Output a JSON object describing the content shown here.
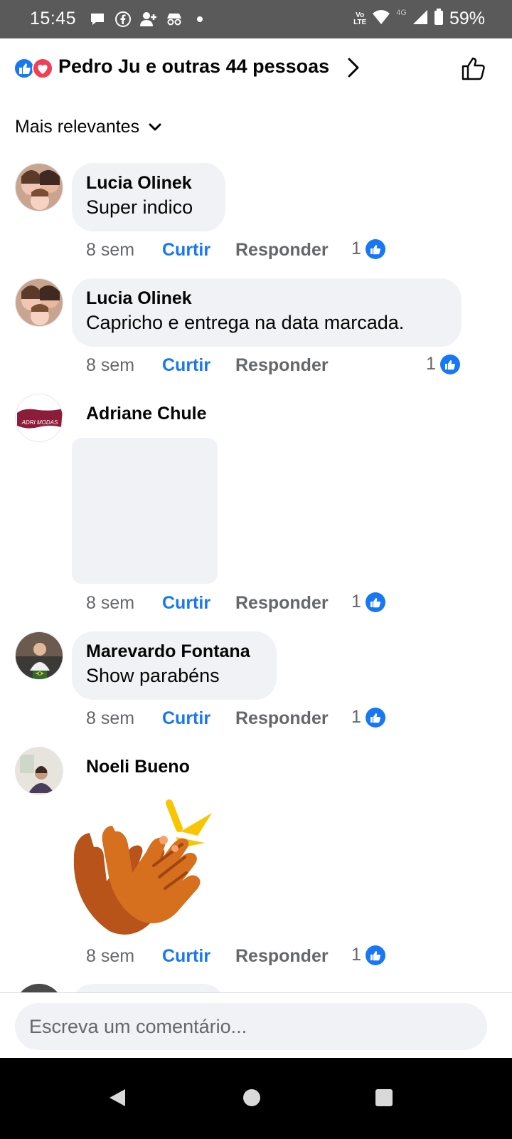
{
  "status_bar": {
    "time": "15:45",
    "battery": "59%",
    "network": "4G",
    "volte_top": "Vo",
    "volte_bottom": "LTE",
    "icons": [
      "message-bubble-icon",
      "facebook-icon",
      "add-person-icon",
      "incognito-icon",
      "dot-icon",
      "volte-icon",
      "wifi-icon",
      "signal-icon",
      "battery-icon"
    ]
  },
  "reactions": {
    "summary": "Pedro Ju e outras 44 pessoas",
    "icons": [
      "like-reaction-icon",
      "love-reaction-icon"
    ]
  },
  "sort": {
    "label": "Mais relevantes"
  },
  "comments": [
    {
      "author": "Lucia Olinek",
      "text": "Super indico",
      "time": "8 sem",
      "like": "Curtir",
      "reply": "Responder",
      "likes": "1"
    },
    {
      "author": "Lucia Olinek",
      "text": "Capricho e entrega na data marcada.",
      "time": "8 sem",
      "like": "Curtir",
      "reply": "Responder",
      "likes": "1"
    },
    {
      "author": "Adriane Chule",
      "avatar_text": "ADRI MODAS",
      "time": "8 sem",
      "like": "Curtir",
      "reply": "Responder",
      "likes": "1"
    },
    {
      "author": "Marevardo Fontana",
      "text": "Show parabéns",
      "time": "8 sem",
      "like": "Curtir",
      "reply": "Responder",
      "likes": "1"
    },
    {
      "author": "Noeli Bueno",
      "sticker": "clapping-hands",
      "time": "8 sem",
      "like": "Curtir",
      "reply": "Responder",
      "likes": "1"
    }
  ],
  "composer": {
    "placeholder": "Escreva um comentário..."
  },
  "colors": {
    "accent": "#1877f2",
    "love": "#f33e58",
    "bubble": "#f0f2f5",
    "muted": "#65676b"
  }
}
